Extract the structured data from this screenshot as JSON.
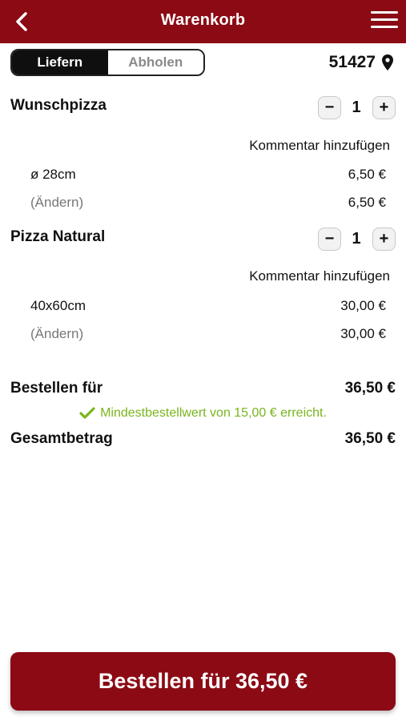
{
  "header": {
    "title": "Warenkorb",
    "back_icon": "back-chevron-icon",
    "menu_icon": "hamburger-menu-icon"
  },
  "mode_toggle": {
    "options": [
      "Liefern",
      "Abholen"
    ],
    "selected": "Liefern"
  },
  "location": {
    "zip": "51427",
    "icon": "map-pin-icon"
  },
  "cart": {
    "items": [
      {
        "name": "Wunschpizza",
        "quantity": "1",
        "minus": "−",
        "plus": "+",
        "comment_label": "Kommentar hinzufügen",
        "size_label": "ø 28cm",
        "size_price": "6,50 €",
        "change_label": "(Ändern)",
        "total_price": "6,50 €"
      },
      {
        "name": "Pizza Natural",
        "quantity": "1",
        "minus": "−",
        "plus": "+",
        "comment_label": "Kommentar hinzufügen",
        "size_label": "40x60cm",
        "size_price": "30,00 €",
        "change_label": "(Ändern)",
        "total_price": "30,00 €"
      }
    ]
  },
  "summary": {
    "order_for_label": "Bestellen für",
    "order_for_value": "36,50 €",
    "min_order_note": "Mindestbestellwert von 15,00 € erreicht.",
    "min_order_color": "#7ab51d",
    "total_label": "Gesamtbetrag",
    "total_value": "36,50 €"
  },
  "order_button": {
    "label": "Bestellen für 36,50 €"
  },
  "colors": {
    "brand": "#8b0a14",
    "success": "#7ab51d"
  }
}
